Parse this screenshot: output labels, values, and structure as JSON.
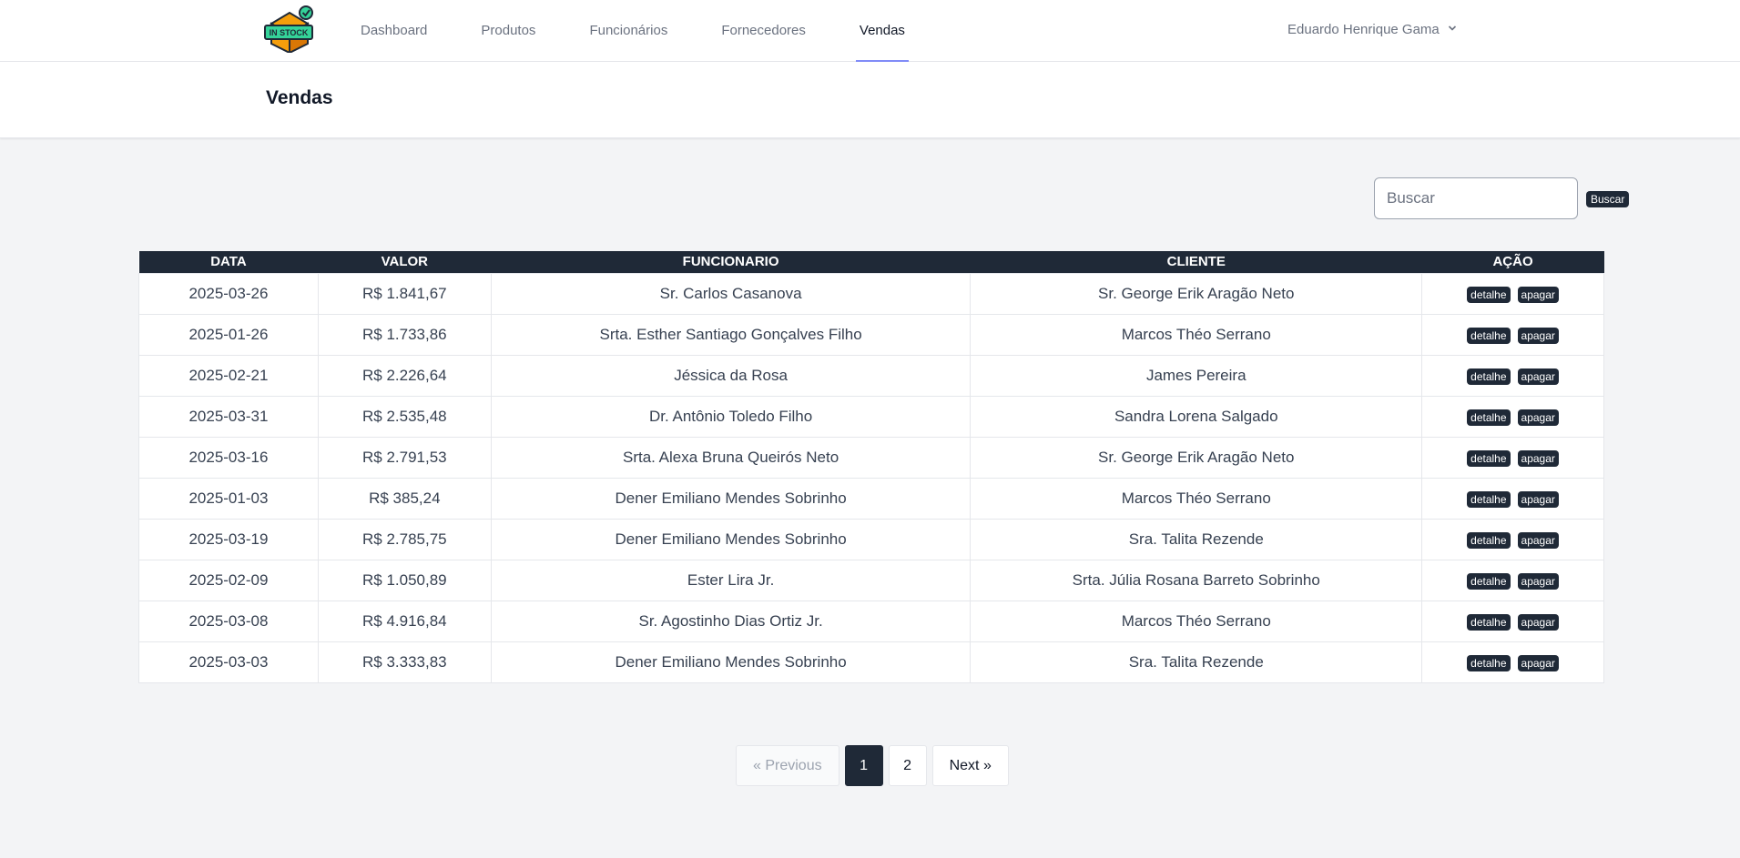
{
  "nav": {
    "logo_text": "IN STOCK",
    "links": [
      "Dashboard",
      "Produtos",
      "Funcionários",
      "Fornecedores",
      "Vendas"
    ],
    "active": "Vendas",
    "user_name": "Eduardo Henrique Gama",
    "user_menu_icon": "chevron-down-icon"
  },
  "header": {
    "title": "Vendas"
  },
  "search": {
    "placeholder": "Buscar",
    "button_label": "Buscar"
  },
  "table": {
    "columns": [
      "DATA",
      "VALOR",
      "FUNCIONARIO",
      "CLIENTE",
      "AÇÃO"
    ],
    "action_labels": {
      "detail": "detalhe",
      "delete": "apagar"
    },
    "rows": [
      {
        "data": "2025-03-26",
        "valor": "R$ 1.841,67",
        "funcionario": "Sr. Carlos Casanova",
        "cliente": "Sr. George Erik Aragão Neto"
      },
      {
        "data": "2025-01-26",
        "valor": "R$ 1.733,86",
        "funcionario": "Srta. Esther Santiago Gonçalves Filho",
        "cliente": "Marcos Théo Serrano"
      },
      {
        "data": "2025-02-21",
        "valor": "R$ 2.226,64",
        "funcionario": "Jéssica da Rosa",
        "cliente": "James Pereira"
      },
      {
        "data": "2025-03-31",
        "valor": "R$ 2.535,48",
        "funcionario": "Dr. Antônio Toledo Filho",
        "cliente": "Sandra Lorena Salgado"
      },
      {
        "data": "2025-03-16",
        "valor": "R$ 2.791,53",
        "funcionario": "Srta. Alexa Bruna Queirós Neto",
        "cliente": "Sr. George Erik Aragão Neto"
      },
      {
        "data": "2025-01-03",
        "valor": "R$ 385,24",
        "funcionario": "Dener Emiliano Mendes Sobrinho",
        "cliente": "Marcos Théo Serrano"
      },
      {
        "data": "2025-03-19",
        "valor": "R$ 2.785,75",
        "funcionario": "Dener Emiliano Mendes Sobrinho",
        "cliente": "Sra. Talita Rezende"
      },
      {
        "data": "2025-02-09",
        "valor": "R$ 1.050,89",
        "funcionario": "Ester Lira Jr.",
        "cliente": "Srta. Júlia Rosana Barreto Sobrinho"
      },
      {
        "data": "2025-03-08",
        "valor": "R$ 4.916,84",
        "funcionario": "Sr. Agostinho Dias Ortiz Jr.",
        "cliente": "Marcos Théo Serrano"
      },
      {
        "data": "2025-03-03",
        "valor": "R$ 3.333,83",
        "funcionario": "Dener Emiliano Mendes Sobrinho",
        "cliente": "Sra. Talita Rezende"
      }
    ]
  },
  "pagination": {
    "previous": "« Previous",
    "pages": [
      "1",
      "2"
    ],
    "current": "1",
    "next": "Next »"
  },
  "colors": {
    "dark": "#1f2937",
    "accent": "#818cf8",
    "background": "#f3f4f6"
  }
}
